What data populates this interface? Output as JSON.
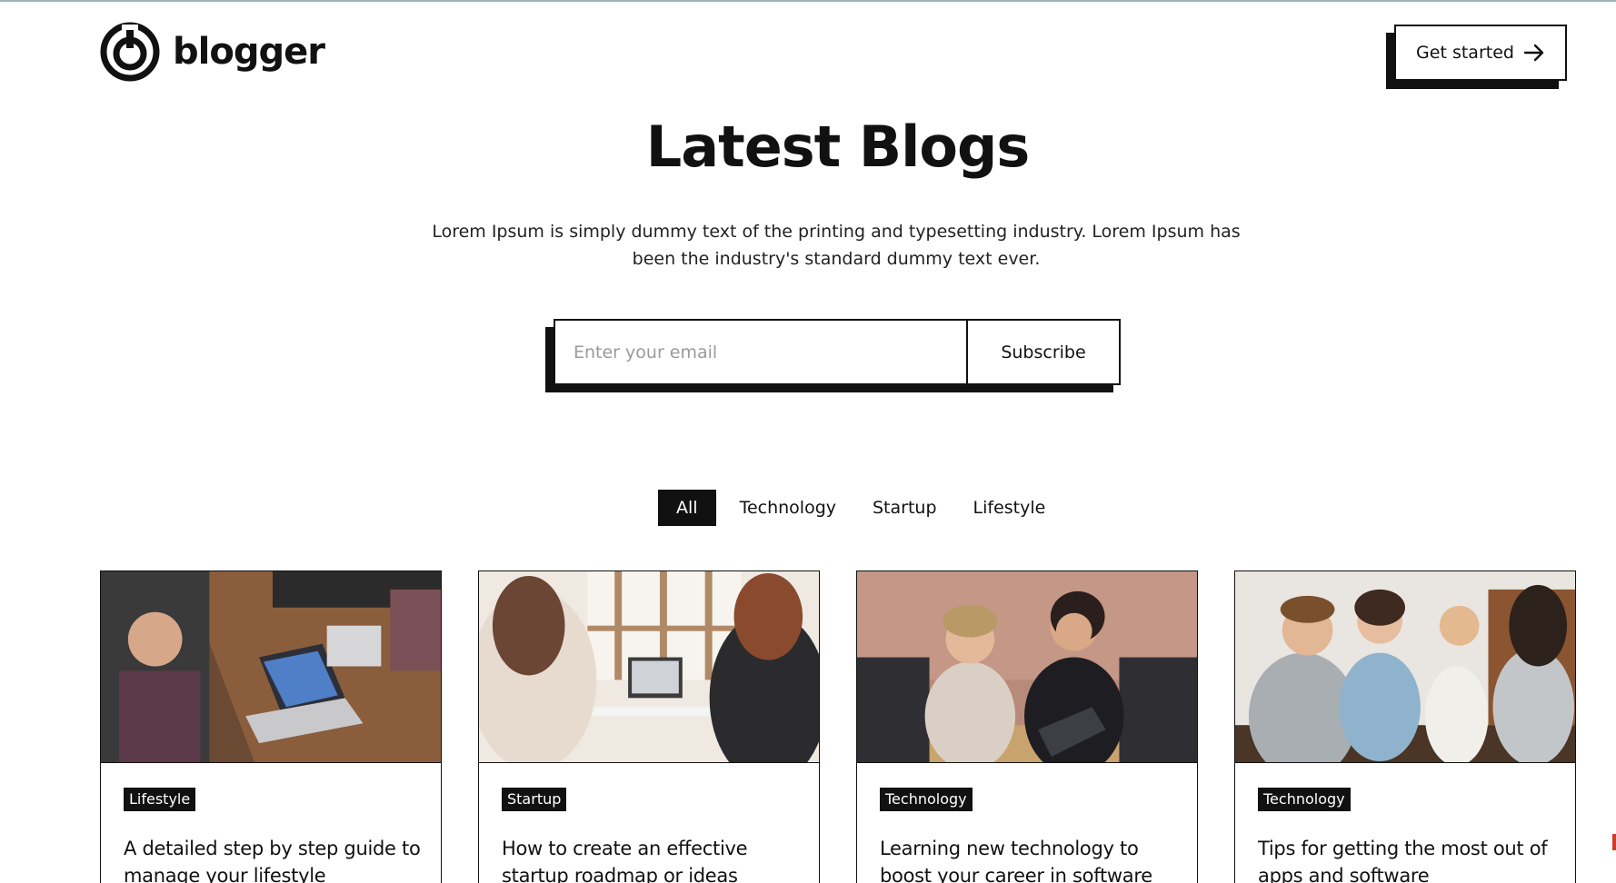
{
  "header": {
    "brand": "blogger",
    "cta_label": "Get started"
  },
  "hero": {
    "title": "Latest Blogs",
    "subtitle": "Lorem Ipsum is simply dummy text of the printing and typesetting industry. Lorem Ipsum has been the industry's standard dummy text ever."
  },
  "subscribe": {
    "placeholder": "Enter your email",
    "value": "",
    "button_label": "Subscribe"
  },
  "tabs": [
    {
      "label": "All",
      "active": true
    },
    {
      "label": "Technology",
      "active": false
    },
    {
      "label": "Startup",
      "active": false
    },
    {
      "label": "Lifestyle",
      "active": false
    }
  ],
  "cards": [
    {
      "category": "Lifestyle",
      "title": "A detailed step by step guide to manage your lifestyle",
      "image": "photo-team-laptops"
    },
    {
      "category": "Startup",
      "title": "How to create an effective startup roadmap or ideas",
      "image": "photo-women-laptop-window"
    },
    {
      "category": "Technology",
      "title": "Learning new technology to boost your career in software",
      "image": "photo-women-tablet-office"
    },
    {
      "category": "Technology",
      "title": "Tips for getting the most out of apps and software",
      "image": "photo-friends-cafe"
    }
  ],
  "colors": {
    "text": "#111111",
    "background": "#ffffff",
    "accent": "#111111"
  },
  "icons": {
    "logo": "power-icon",
    "cta": "arrow-right-icon"
  }
}
